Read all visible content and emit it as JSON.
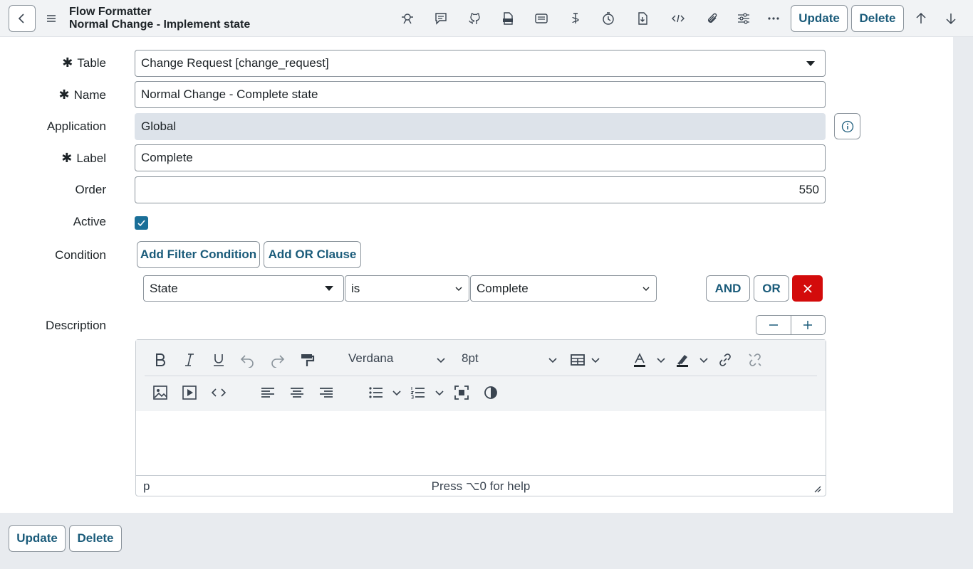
{
  "header": {
    "title": "Flow Formatter",
    "subtitle": "Normal Change - Implement state",
    "update_label": "Update",
    "delete_label": "Delete",
    "icons": [
      "agent-icon",
      "comment-icon",
      "github-icon",
      "xml-icon",
      "list-icon",
      "script-icon",
      "history-icon",
      "download-icon",
      "code-icon",
      "attachment-icon",
      "settings-sliders-icon",
      "more-icon"
    ]
  },
  "form": {
    "table_label": "Table",
    "table_value": "Change Request [change_request]",
    "name_label": "Name",
    "name_value": "Normal Change - Complete state",
    "application_label": "Application",
    "application_value": "Global",
    "label_label": "Label",
    "label_value": "Complete",
    "order_label": "Order",
    "order_value": "550",
    "active_label": "Active",
    "active_checked": true,
    "condition_label": "Condition",
    "add_filter_label": "Add Filter Condition",
    "add_or_label": "Add OR Clause",
    "condition_field": "State",
    "condition_operator": "is",
    "condition_value": "Complete",
    "and_label": "AND",
    "or_label": "OR",
    "description_label": "Description"
  },
  "editor": {
    "font": "Verdana",
    "size": "8pt",
    "element": "p",
    "help": "Press ⌥0 for help"
  },
  "footer": {
    "update_label": "Update",
    "delete_label": "Delete"
  },
  "colors": {
    "accent": "#1a5b7a",
    "danger": "#d30b0b",
    "checkbox": "#1a6f98"
  }
}
